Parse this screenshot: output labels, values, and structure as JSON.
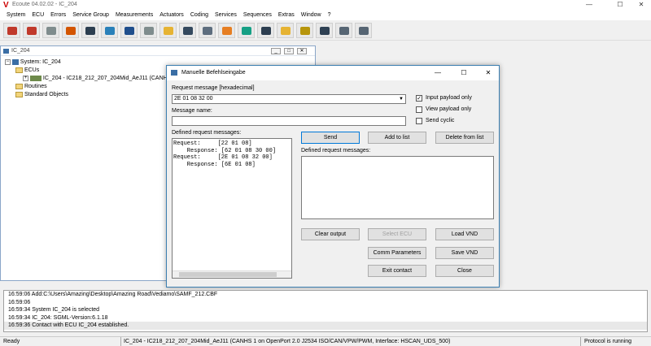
{
  "window": {
    "title": "Ecoute 04.02.02 - IC_204",
    "logo": "V",
    "minimize_glyph": "—",
    "maximize_glyph": "☐",
    "close_glyph": "✕"
  },
  "menu": [
    "System",
    "ECU",
    "Errors",
    "Service Group",
    "Measurements",
    "Actuators",
    "Coding",
    "Services",
    "Sequences",
    "Extras",
    "Window",
    "?"
  ],
  "toolbar": {
    "icons": [
      "disconnect-icon",
      "connect-icon",
      "check-icon",
      "refresh-icon",
      "car-icon",
      "ecu-list-icon",
      "vehicle-icon",
      "table-icon",
      "folder-icon",
      "eye-icon",
      "network-icon",
      "flash-icon",
      "data-icon",
      "grid-icon",
      "report-icon",
      "gear-icon",
      "house-icon",
      "users-icon",
      "export-icon"
    ],
    "colors": [
      "#c0392b",
      "#c0392b",
      "#7f8c8d",
      "#d35400",
      "#2c3e50",
      "#2980b9",
      "#1f4e8c",
      "#7f8c8d",
      "#e6b333",
      "#34495e",
      "#5d6d7e",
      "#e67e22",
      "#16a085",
      "#2c3e50",
      "#e6b333",
      "#b7950b",
      "#2e4053",
      "#566573",
      "#566573"
    ]
  },
  "child_window": {
    "title": "IC_204",
    "buttons": [
      "_",
      "□",
      "✕"
    ],
    "tree": {
      "root": "System: IC_204",
      "ecus_label": "ECUs",
      "ecu_item": "IC_204 - IC218_212_207_204Mid_AeJ11 (CANH",
      "routines_label": "Routines",
      "standard_objects_label": "Standard Objects"
    }
  },
  "dialog": {
    "title": "Manuelle Befehlseingabe",
    "request_label": "Request message [hexadecimal]",
    "request_value": "2E 01 08 32 00",
    "message_name_label": "Message name:",
    "message_name_value": "",
    "input_payload_only": {
      "label": "Input payload only",
      "checked": true
    },
    "view_payload_only": {
      "label": "View payload only",
      "checked": false
    },
    "send_cyclic": {
      "label": "Send cyclic",
      "checked": false
    },
    "defined_left_label": "Defined request messages:",
    "output_lines": [
      "Request:     [22 01 08]",
      "    Response: [62 01 08 30 00]",
      "Request:     [2E 01 08 32 00]",
      "    Response: [6E 01 08]"
    ],
    "send_btn": "Send",
    "add_btn": "Add to list",
    "delete_btn": "Delete from list",
    "defined_right_label": "Defined request messages:",
    "clear_btn": "Clear output",
    "select_ecu_btn": "Select ECU",
    "load_btn": "Load VND",
    "comm_btn": "Comm Parameters",
    "save_btn": "Save VND",
    "exit_btn": "Exit contact",
    "close_btn": "Close"
  },
  "log": [
    "16:59:06 Add:C:\\Users\\Amazing\\Desktop\\Amazing Road\\Vediamo\\SAMF_212.CBF",
    "16:59:06",
    "16:59:34 System IC_204 is selected",
    "16:59:34 IC_204: SGML-Version:6.1.18",
    "16:59:36 Contact with ECU IC_204 established."
  ],
  "status": {
    "left": "Ready",
    "middle": "IC_204 - IC218_212_207_204Mid_AeJ11 (CANHS 1 on OpenPort 2.0 J2534 ISO/CAN/VPW/PWM, Interface: HSCAN_UDS_500)",
    "right": "Protocol is running"
  }
}
